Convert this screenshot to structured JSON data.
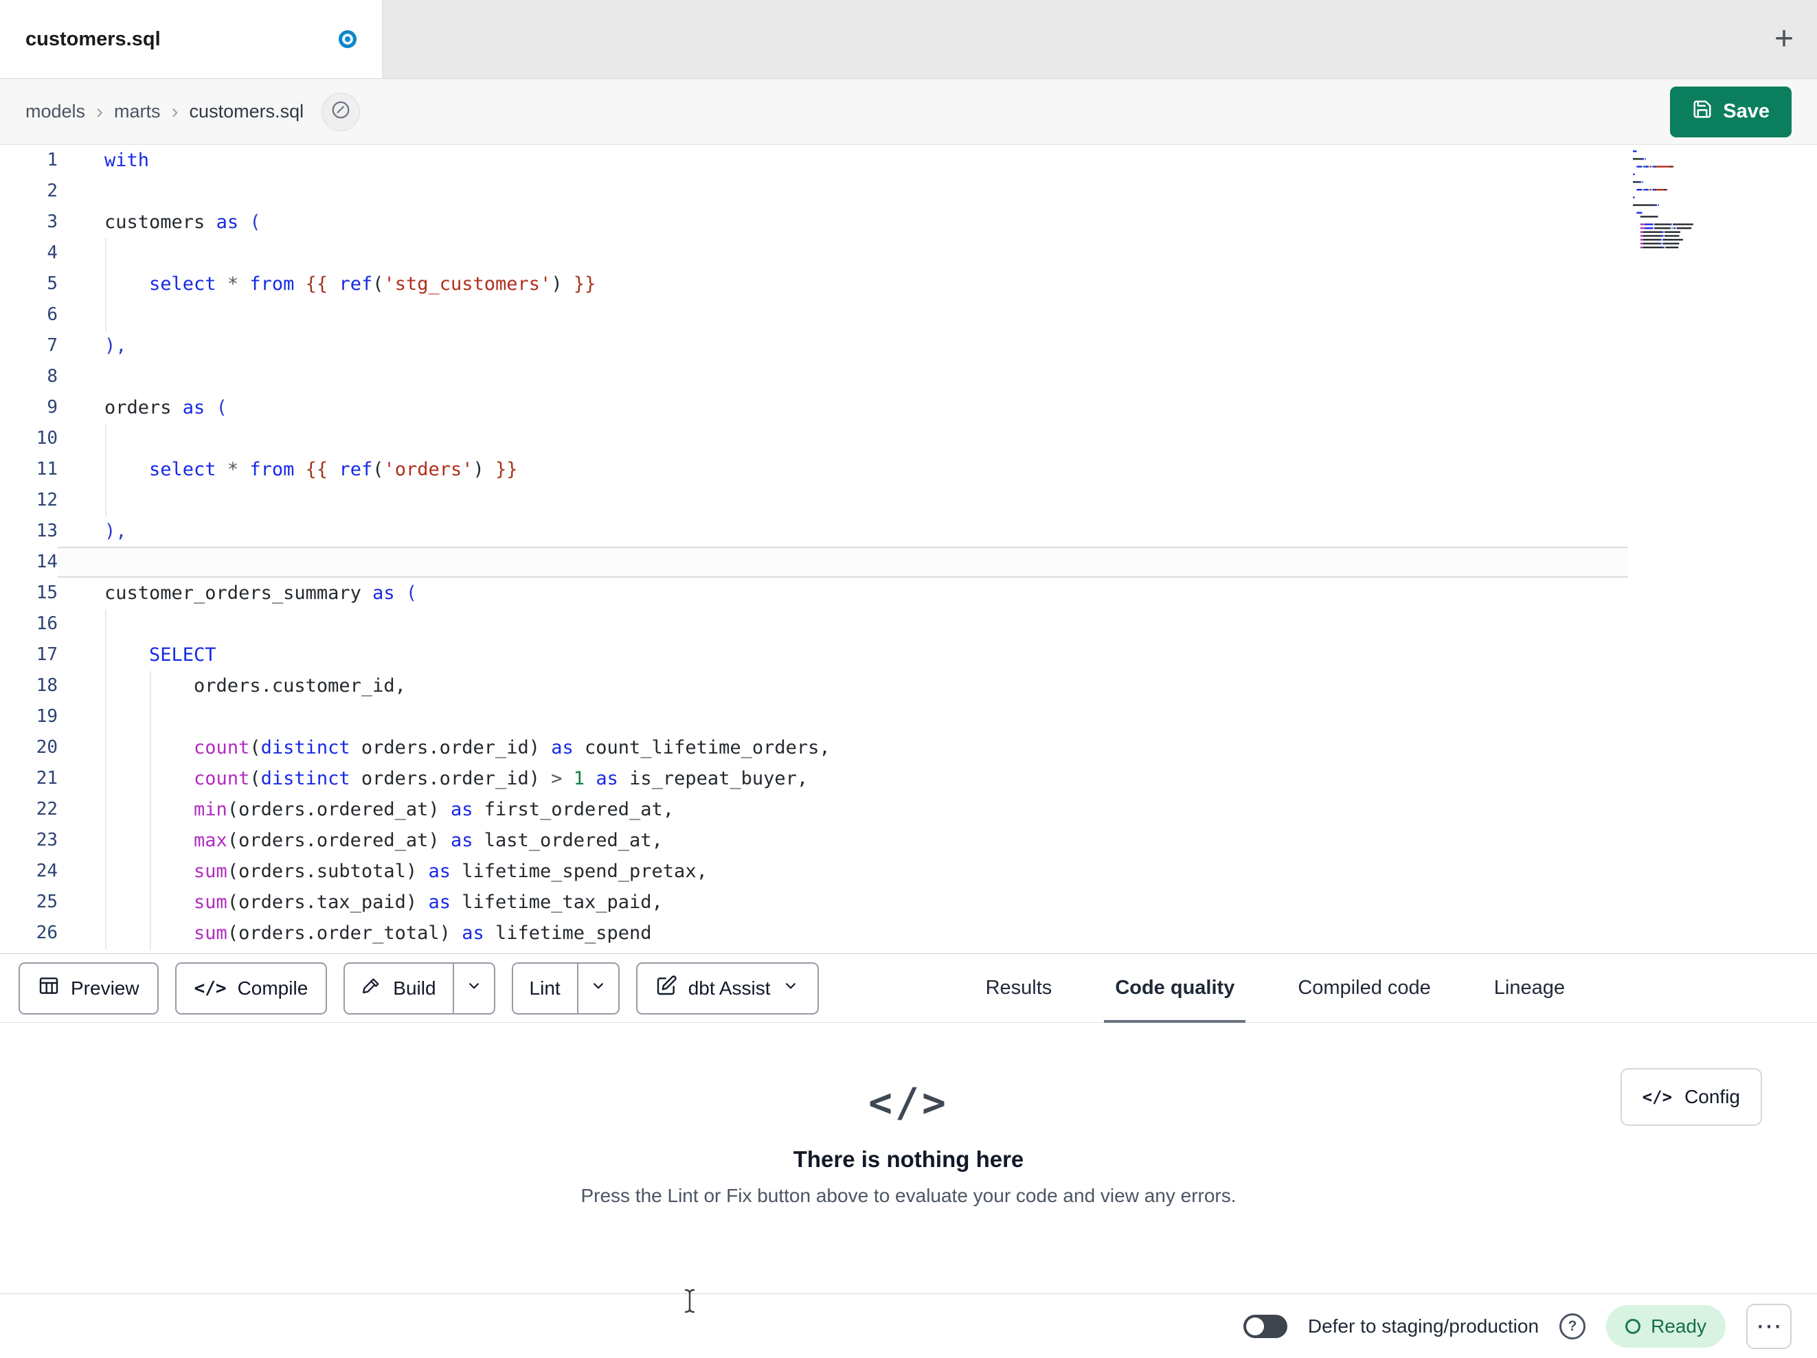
{
  "tab_bar": {
    "active_tab": {
      "label": "customers.sql",
      "modified": true
    },
    "new_tab_label": "+"
  },
  "breadcrumb": {
    "items": [
      "models",
      "marts",
      "customers.sql"
    ],
    "separator": "›"
  },
  "header": {
    "save_label": "Save"
  },
  "editor": {
    "active_line": 14,
    "token_colors": {
      "kw": "#1629e6",
      "fn": "#b22cc0",
      "str": "#b02e1d",
      "jinja": "#a5341c",
      "br": "#2b3bd6",
      "num": "#0f8048",
      "op": "#555b63",
      "plain": "#24292e"
    },
    "lines": [
      {
        "n": 1,
        "seg": [
          [
            "kw",
            "with"
          ]
        ]
      },
      {
        "n": 2,
        "seg": []
      },
      {
        "n": 3,
        "seg": [
          [
            "plain",
            "customers "
          ],
          [
            "kw",
            "as"
          ],
          [
            "plain",
            " "
          ],
          [
            "br",
            "("
          ]
        ]
      },
      {
        "n": 4,
        "seg": []
      },
      {
        "n": 5,
        "seg": [
          [
            "plain",
            "    "
          ],
          [
            "kw",
            "select"
          ],
          [
            "op",
            " * "
          ],
          [
            "kw",
            "from"
          ],
          [
            "plain",
            " "
          ],
          [
            "jinja",
            "{{"
          ],
          [
            "plain",
            " "
          ],
          [
            "kw",
            "ref"
          ],
          [
            "plain",
            "("
          ],
          [
            "str",
            "'stg_customers'"
          ],
          [
            "plain",
            ") "
          ],
          [
            "jinja",
            "}}"
          ]
        ]
      },
      {
        "n": 6,
        "seg": []
      },
      {
        "n": 7,
        "seg": [
          [
            "br",
            "),"
          ]
        ]
      },
      {
        "n": 8,
        "seg": []
      },
      {
        "n": 9,
        "seg": [
          [
            "plain",
            "orders "
          ],
          [
            "kw",
            "as"
          ],
          [
            "plain",
            " "
          ],
          [
            "br",
            "("
          ]
        ]
      },
      {
        "n": 10,
        "seg": []
      },
      {
        "n": 11,
        "seg": [
          [
            "plain",
            "    "
          ],
          [
            "kw",
            "select"
          ],
          [
            "op",
            " * "
          ],
          [
            "kw",
            "from"
          ],
          [
            "plain",
            " "
          ],
          [
            "jinja",
            "{{"
          ],
          [
            "plain",
            " "
          ],
          [
            "kw",
            "ref"
          ],
          [
            "plain",
            "("
          ],
          [
            "str",
            "'orders'"
          ],
          [
            "plain",
            ") "
          ],
          [
            "jinja",
            "}}"
          ]
        ]
      },
      {
        "n": 12,
        "seg": []
      },
      {
        "n": 13,
        "seg": [
          [
            "br",
            "),"
          ]
        ]
      },
      {
        "n": 14,
        "seg": []
      },
      {
        "n": 15,
        "seg": [
          [
            "plain",
            "customer_orders_summary "
          ],
          [
            "kw",
            "as"
          ],
          [
            "plain",
            " "
          ],
          [
            "br",
            "("
          ]
        ]
      },
      {
        "n": 16,
        "seg": []
      },
      {
        "n": 17,
        "seg": [
          [
            "plain",
            "    "
          ],
          [
            "kw",
            "SELECT"
          ]
        ]
      },
      {
        "n": 18,
        "seg": [
          [
            "plain",
            "        orders.customer_id,"
          ]
        ]
      },
      {
        "n": 19,
        "seg": []
      },
      {
        "n": 20,
        "seg": [
          [
            "plain",
            "        "
          ],
          [
            "fn",
            "count"
          ],
          [
            "plain",
            "("
          ],
          [
            "kw",
            "distinct"
          ],
          [
            "plain",
            " orders.order_id) "
          ],
          [
            "kw",
            "as"
          ],
          [
            "plain",
            " count_lifetime_orders,"
          ]
        ]
      },
      {
        "n": 21,
        "seg": [
          [
            "plain",
            "        "
          ],
          [
            "fn",
            "count"
          ],
          [
            "plain",
            "("
          ],
          [
            "kw",
            "distinct"
          ],
          [
            "plain",
            " orders.order_id) "
          ],
          [
            "op",
            ">"
          ],
          [
            "plain",
            " "
          ],
          [
            "num",
            "1"
          ],
          [
            "plain",
            " "
          ],
          [
            "kw",
            "as"
          ],
          [
            "plain",
            " is_repeat_buyer,"
          ]
        ]
      },
      {
        "n": 22,
        "seg": [
          [
            "plain",
            "        "
          ],
          [
            "fn",
            "min"
          ],
          [
            "plain",
            "(orders.ordered_at) "
          ],
          [
            "kw",
            "as"
          ],
          [
            "plain",
            " first_ordered_at,"
          ]
        ]
      },
      {
        "n": 23,
        "seg": [
          [
            "plain",
            "        "
          ],
          [
            "fn",
            "max"
          ],
          [
            "plain",
            "(orders.ordered_at) "
          ],
          [
            "kw",
            "as"
          ],
          [
            "plain",
            " last_ordered_at,"
          ]
        ]
      },
      {
        "n": 24,
        "seg": [
          [
            "plain",
            "        "
          ],
          [
            "fn",
            "sum"
          ],
          [
            "plain",
            "(orders.subtotal) "
          ],
          [
            "kw",
            "as"
          ],
          [
            "plain",
            " lifetime_spend_pretax,"
          ]
        ]
      },
      {
        "n": 25,
        "seg": [
          [
            "plain",
            "        "
          ],
          [
            "fn",
            "sum"
          ],
          [
            "plain",
            "(orders.tax_paid) "
          ],
          [
            "kw",
            "as"
          ],
          [
            "plain",
            " lifetime_tax_paid,"
          ]
        ]
      },
      {
        "n": 26,
        "seg": [
          [
            "plain",
            "        "
          ],
          [
            "fn",
            "sum"
          ],
          [
            "plain",
            "(orders.order_total) "
          ],
          [
            "kw",
            "as"
          ],
          [
            "plain",
            " lifetime_spend"
          ]
        ]
      }
    ]
  },
  "toolbar": {
    "preview_label": "Preview",
    "compile_label": "Compile",
    "build_label": "Build",
    "lint_label": "Lint",
    "assist_label": "dbt Assist",
    "tabs": [
      {
        "label": "Results",
        "active": false
      },
      {
        "label": "Code quality",
        "active": true
      },
      {
        "label": "Compiled code",
        "active": false
      },
      {
        "label": "Lineage",
        "active": false
      }
    ]
  },
  "results_panel": {
    "icon_glyph": "</>",
    "title": "There is nothing here",
    "subtitle": "Press the Lint or Fix button above to evaluate your code and view any errors.",
    "config_label": "Config",
    "config_icon_glyph": "</>"
  },
  "status_bar": {
    "defer_label": "Defer to staging/production",
    "help_glyph": "?",
    "ready_label": "Ready",
    "more_glyph": "⋯",
    "toggle_on": false
  },
  "colors": {
    "save_green": "#0b7e5e",
    "ready_bg": "#d8f3e2",
    "ready_text": "#166e4b",
    "modified_dot_blue": "#0e87c8"
  }
}
